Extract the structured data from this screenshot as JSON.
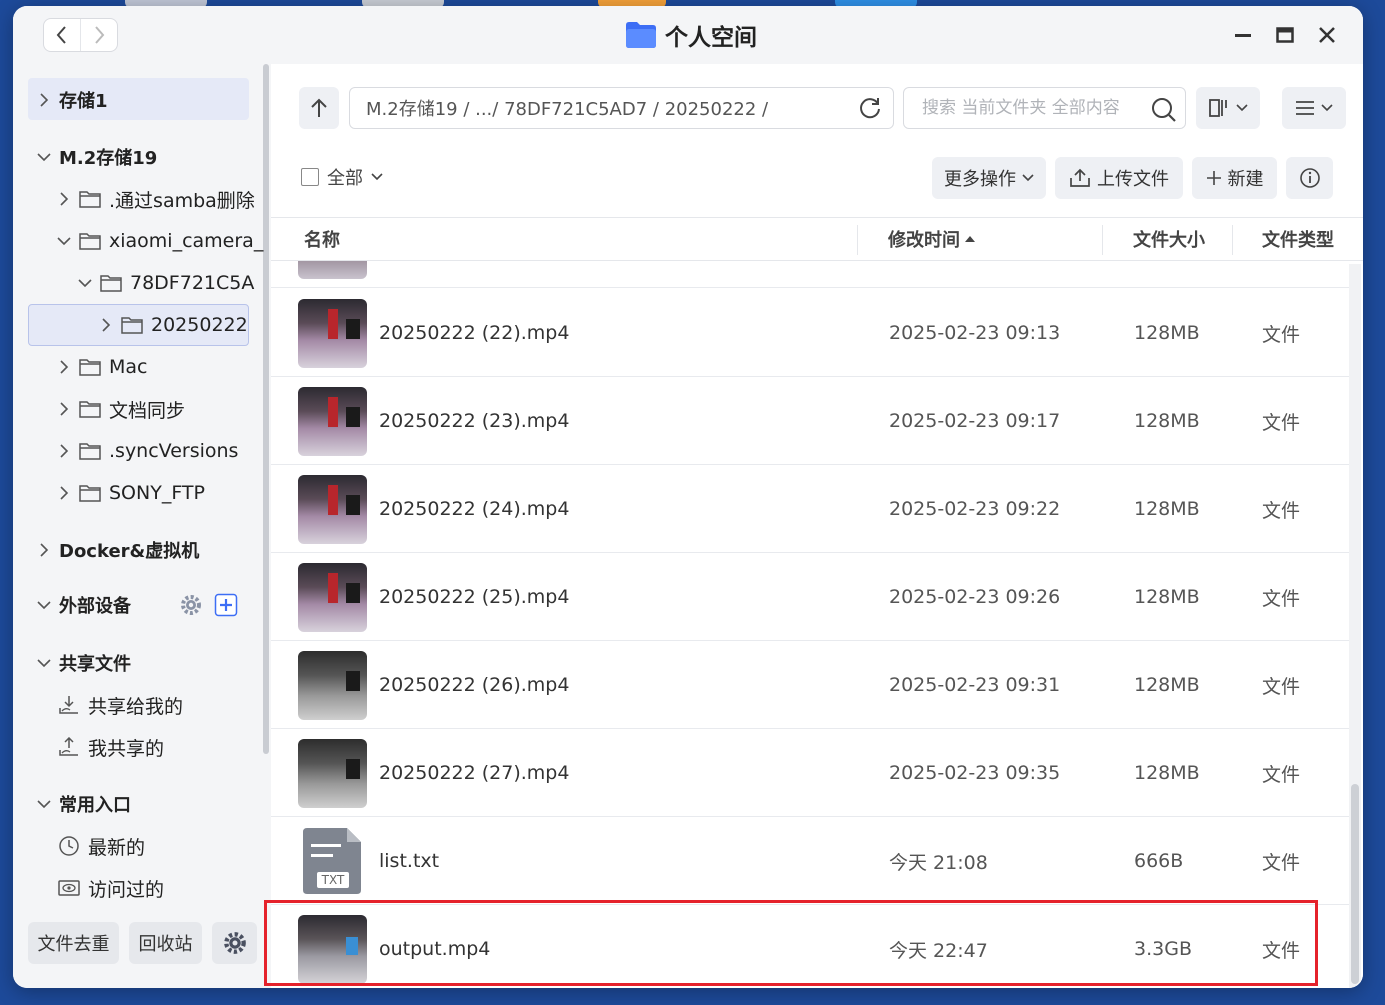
{
  "window": {
    "title": "个人空间",
    "accent": "#3d6ef5",
    "highlight": "#e5222b"
  },
  "nav": {
    "back_icon": "chevron-left-icon",
    "forward_icon": "chevron-right-icon"
  },
  "sidebar": {
    "storage1": "存储1",
    "m2": "M.2存储19",
    "tree": [
      {
        "label": ".通过samba删除"
      },
      {
        "label": "xiaomi_camera_"
      },
      {
        "label": "78DF721C5A"
      },
      {
        "label": "20250222"
      },
      {
        "label": "Mac"
      },
      {
        "label": "文档同步"
      },
      {
        "label": ".syncVersions"
      },
      {
        "label": "SONY_FTP"
      }
    ],
    "docker": "Docker&虚拟机",
    "external": "外部设备",
    "shared": "共享文件",
    "shared_to_me": "共享给我的",
    "my_shared": "我共享的",
    "common": "常用入口",
    "recent": "最新的",
    "visited": "访问过的",
    "dedupe_button": "文件去重",
    "recycle_button": "回收站"
  },
  "toolbar": {
    "path": "M.2存储19 / .../ 78DF721C5AD7 / 20250222 /",
    "search_placeholder": "搜索 当前文件夹 全部内容",
    "select_all": "全部",
    "more_actions": "更多操作",
    "upload": "上传文件",
    "new": "新建"
  },
  "table": {
    "headers": {
      "name": "名称",
      "modified": "修改时间",
      "size": "文件大小",
      "type": "文件类型"
    },
    "rows": [
      {
        "name": "20250222 (22).mp4",
        "modified": "2025-02-23 09:13",
        "size": "128MB",
        "type": "文件"
      },
      {
        "name": "20250222 (23).mp4",
        "modified": "2025-02-23 09:17",
        "size": "128MB",
        "type": "文件"
      },
      {
        "name": "20250222 (24).mp4",
        "modified": "2025-02-23 09:22",
        "size": "128MB",
        "type": "文件"
      },
      {
        "name": "20250222 (25).mp4",
        "modified": "2025-02-23 09:26",
        "size": "128MB",
        "type": "文件"
      },
      {
        "name": "20250222 (26).mp4",
        "modified": "2025-02-23 09:31",
        "size": "128MB",
        "type": "文件"
      },
      {
        "name": "20250222 (27).mp4",
        "modified": "2025-02-23 09:35",
        "size": "128MB",
        "type": "文件"
      },
      {
        "name": "list.txt",
        "modified": "今天 21:08",
        "size": "666B",
        "type": "文件",
        "icon_label": "TXT"
      },
      {
        "name": "output.mp4",
        "modified": "今天 22:47",
        "size": "3.3GB",
        "type": "文件"
      }
    ]
  }
}
